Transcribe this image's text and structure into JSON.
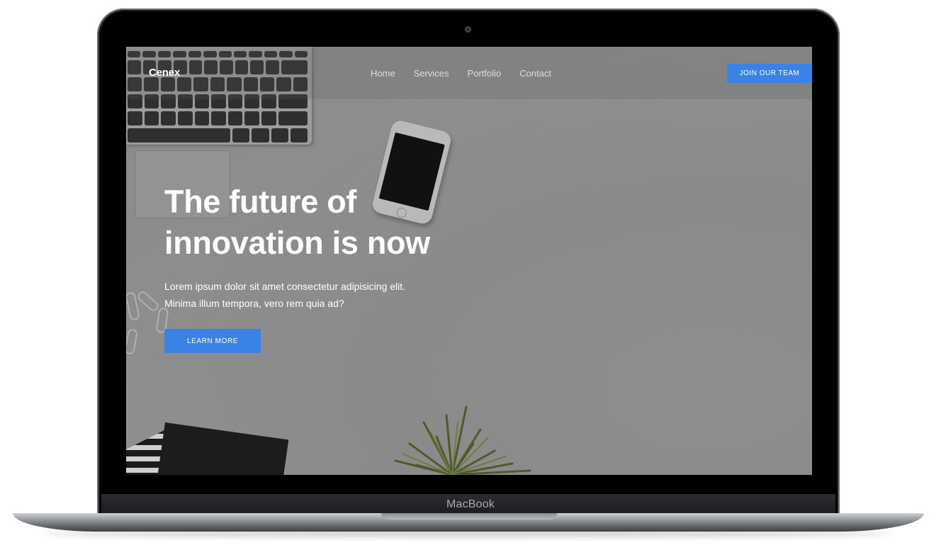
{
  "device": {
    "label": "MacBook"
  },
  "site": {
    "brand": "Cenex",
    "nav": [
      {
        "label": "Home"
      },
      {
        "label": "Services"
      },
      {
        "label": "Portfolio"
      },
      {
        "label": "Contact"
      }
    ],
    "cta_top": "JOIN OUR TEAM",
    "hero": {
      "title_line1": "The future of",
      "title_line2": "innovation is now",
      "subtitle_line1": "Lorem ipsum dolor sit amet consectetur adipisicing elit.",
      "subtitle_line2": "Minima illum tempora, vero rem quia ad?",
      "cta": "LEARN MORE"
    }
  },
  "colors": {
    "accent": "#3b82e6",
    "overlay": "#8b8b8b",
    "frame": "#000000",
    "text": "#ffffff"
  }
}
